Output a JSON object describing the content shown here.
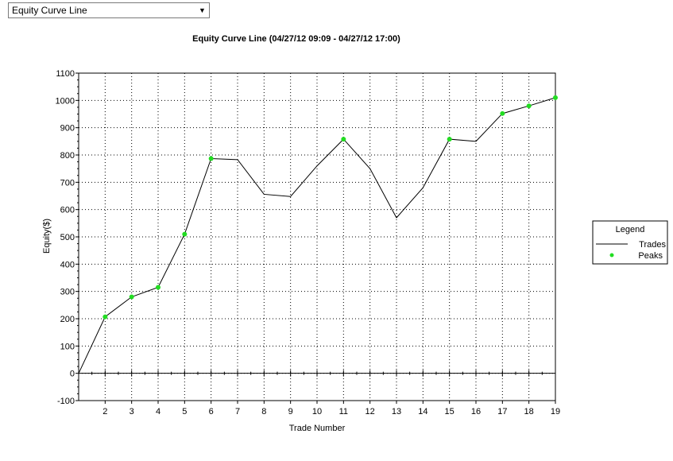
{
  "selector": {
    "value": "Equity Curve Line",
    "icon": "chevron-down-icon"
  },
  "chart_data": {
    "type": "line",
    "title": "Equity Curve Line (04/27/12 09:09 - 04/27/12 17:00)",
    "xlabel": "Trade Number",
    "ylabel": "Equity($)",
    "xlim": [
      1,
      19
    ],
    "ylim": [
      -100,
      1100
    ],
    "x_ticks": [
      2,
      3,
      4,
      5,
      6,
      7,
      8,
      9,
      10,
      11,
      12,
      13,
      14,
      15,
      16,
      17,
      18,
      19
    ],
    "y_ticks": [
      -100,
      0,
      100,
      200,
      300,
      400,
      500,
      600,
      700,
      800,
      900,
      1000,
      1100
    ],
    "grid": true,
    "legend_placement": "right",
    "series": [
      {
        "name": "Trades",
        "kind": "line",
        "color": "#000000",
        "x": [
          1,
          2,
          3,
          4,
          5,
          6,
          7,
          8,
          9,
          10,
          11,
          12,
          13,
          14,
          15,
          16,
          17,
          18,
          19
        ],
        "y": [
          0,
          207,
          280,
          315,
          510,
          787,
          783,
          656,
          648,
          760,
          858,
          750,
          570,
          680,
          858,
          850,
          952,
          980,
          1010
        ]
      },
      {
        "name": "Peaks",
        "kind": "marker",
        "color": "#22dd22",
        "x": [
          2,
          3,
          4,
          5,
          6,
          11,
          15,
          17,
          18,
          19
        ],
        "y": [
          207,
          280,
          315,
          510,
          787,
          858,
          858,
          952,
          980,
          1010
        ]
      }
    ]
  },
  "legend": {
    "title": "Legend",
    "items": [
      "Trades",
      "Peaks"
    ]
  }
}
